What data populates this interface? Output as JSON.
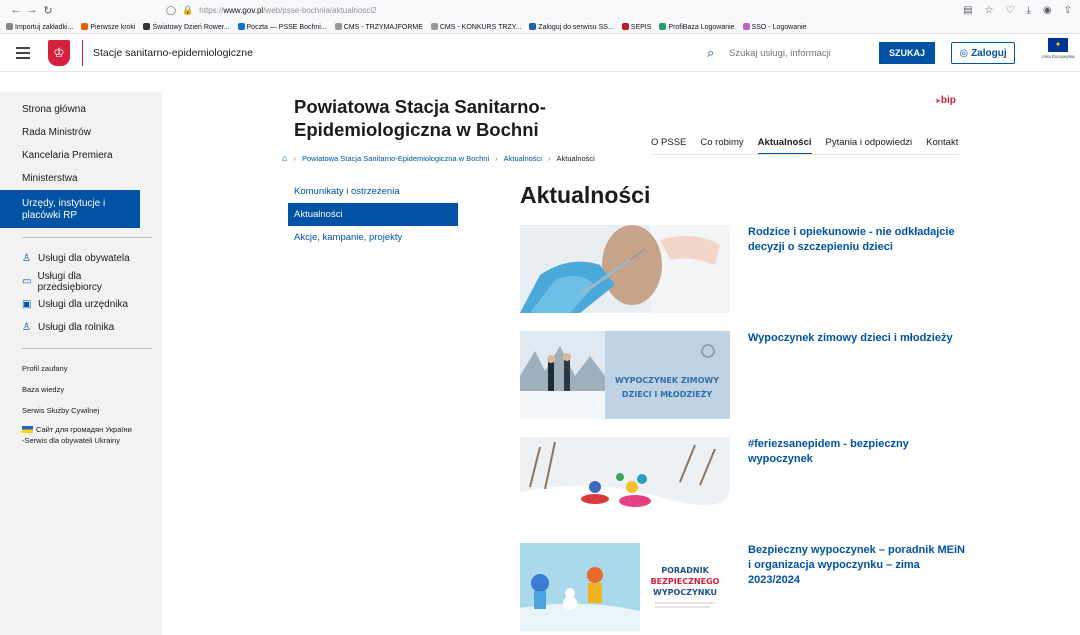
{
  "browser": {
    "url_prefix": "https://",
    "url_host": "www.gov.pl",
    "url_path": "/web/psse-bochnia/aktualnosci2",
    "bookmarks": [
      "Importuj zakładki...",
      "Pierwsze kroki",
      "Światowy Dzień Rower...",
      "Poczta — PSSE Bochni...",
      "CMS - TRZYMAJFORME",
      "CMS - KONKURS TRZY...",
      "Zaloguj do serwisu SS...",
      "SEPIS",
      "ProfiBaza Logowanie",
      "SSO - Logowanie"
    ]
  },
  "header": {
    "site_name": "Stacje sanitarno-epidemiologiczne",
    "search_placeholder": "Szukaj usługi, informacji",
    "search_button": "SZUKAJ",
    "login_button": "Zaloguj",
    "eu_label": "Unia Europejska"
  },
  "sidebar": {
    "items": [
      "Strona główna",
      "Rada Ministrów",
      "Kancelaria Premiera",
      "Ministerstwa"
    ],
    "active_item": "Urzędy, instytucje i placówki RP",
    "services": [
      "Usługi dla obywatela",
      "Usługi dla przedsiębiorcy",
      "Usługi dla urzędnika",
      "Usługi dla rolnika"
    ],
    "links": [
      "Profil zaufany",
      "Baza wiedzy",
      "Serwis Służby Cywilnej"
    ],
    "ukraine_line1": "Сайт для громадян України",
    "ukraine_line2": "-Serwis dla obywateli Ukrainy"
  },
  "main": {
    "org_title": "Powiatowa Stacja Sanitarno-Epidemiologiczna w Bochni",
    "bip": "bip",
    "tabs": [
      "O PSSE",
      "Co robimy",
      "Aktualności",
      "Pytania i odpowiedzi",
      "Kontakt"
    ],
    "active_tab": "Aktualności",
    "breadcrumb": [
      "Powiatowa Stacja Sanitarno-Epidemiologiczna w Bochni",
      "Aktualności",
      "Aktualności"
    ],
    "subnav": [
      "Komunikaty i ostrzeżenia",
      "Aktualności",
      "Akcje, kampanie, projekty"
    ],
    "subnav_active": "Aktualności",
    "heading": "Aktualności",
    "news": [
      {
        "title": "Rodzice i opiekunowie - nie odkładajcie decyzji o szczepieniu dzieci"
      },
      {
        "title": "Wypoczynek zimowy dzieci i młodzieży",
        "image_text": "WYPOCZYNEK ZIMOWY DZIECI I MŁODZIEŻY"
      },
      {
        "title": "#feriezsanepidem - bezpieczny wypoczynek"
      },
      {
        "title": "Bezpieczny wypoczynek – poradnik MEiN i organizacja wypoczynku – zima 2023/2024",
        "image_text_1": "PORADNIK",
        "image_text_2": "BEZPIECZNEGO",
        "image_text_3": "WYPOCZYNKU"
      }
    ]
  },
  "colors": {
    "primary": "#0052a5",
    "accent_red": "#d4213d",
    "sidebar_bg": "#f2f2f2"
  }
}
